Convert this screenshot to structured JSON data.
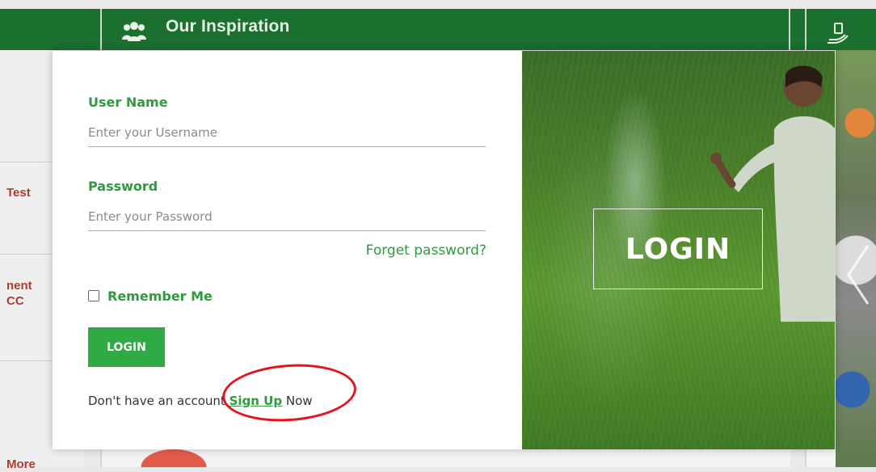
{
  "background": {
    "header_title": "Our Inspiration",
    "left_items": [
      "Test",
      "nent",
      "CC",
      "More"
    ]
  },
  "login_form": {
    "username_label": "User Name",
    "username_placeholder": "Enter your Username",
    "password_label": "Password",
    "password_placeholder": "Enter your Password",
    "forgot_password": "Forget password?",
    "remember_me": "Remember Me",
    "login_button": "LOGIN",
    "signup_prefix": "Don't have an account",
    "signup_link": "Sign Up",
    "signup_suffix": "Now"
  },
  "hero": {
    "title": "LOGIN"
  },
  "colors": {
    "brand_green": "#2f9a3e",
    "header_green": "#1b6f2f",
    "button_green": "#2faa45",
    "annotation_red": "#e3141b"
  },
  "icons": [
    "people-icon",
    "hand-icon",
    "chevron-right-icon"
  ]
}
